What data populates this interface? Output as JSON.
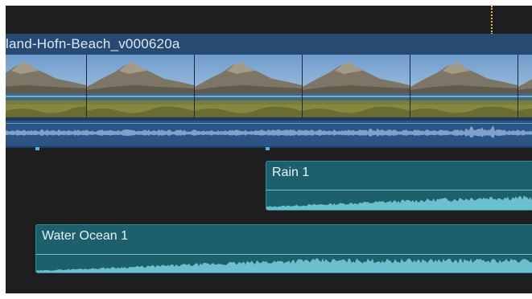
{
  "video_clip": {
    "name": "land-Hofn-Beach_v000620a",
    "color": "#274a72"
  },
  "audio_clips": [
    {
      "name": "Rain 1",
      "color": "#1e5f6c"
    },
    {
      "name": "Water Ocean 1",
      "color": "#1e5f6c"
    }
  ],
  "icons": [
    "playhead-marker",
    "clip-marker"
  ],
  "colors": {
    "background": "#1e1e20",
    "video": "#274a72",
    "audio": "#1e5f6c",
    "playhead": "#e8c23a",
    "marker": "#4fb7d6"
  }
}
